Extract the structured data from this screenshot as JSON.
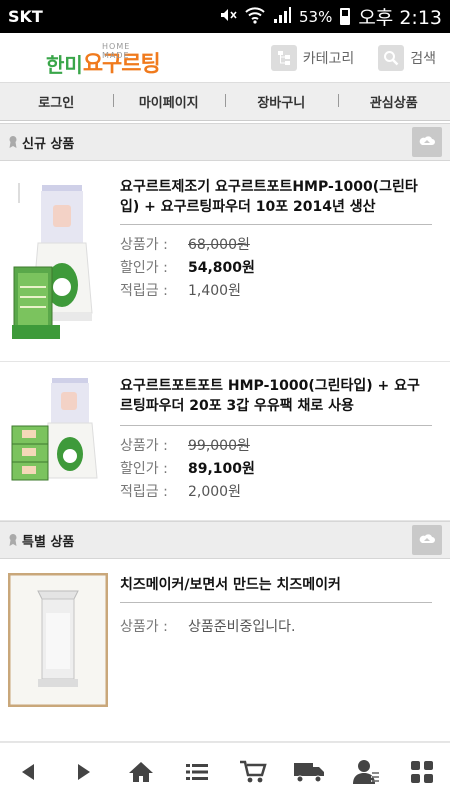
{
  "status_bar": {
    "carrier": "SKT",
    "battery": "53%",
    "time": "오후 2:13"
  },
  "header": {
    "logo_prefix": "한미",
    "logo_main": "요구르팅",
    "logo_sub": "HOME MADE",
    "category_label": "카테고리",
    "search_label": "검색"
  },
  "nav": [
    "로그인",
    "마이페이지",
    "장바구니",
    "관심상품"
  ],
  "sections": {
    "new": {
      "title": "신규 상품",
      "products": [
        {
          "name": "요구르트제조기 요구르트포트HMP-1000(그린타입) + 요구르팅파우더 10포 2014년 생산",
          "price_label": "상품가 :",
          "price": "68,000원",
          "sale_label": "할인가 :",
          "sale_price": "54,800원",
          "points_label": "적립금 :",
          "points": "1,400원"
        },
        {
          "name": "요구르트포트포트 HMP-1000(그린타입) + 요구르팅파우더 20포 3갑 우유팩 채로 사용",
          "price_label": "상품가 :",
          "price": "99,000원",
          "sale_label": "할인가 :",
          "sale_price": "89,100원",
          "points_label": "적립금 :",
          "points": "2,000원"
        }
      ]
    },
    "special": {
      "title": "특별 상품",
      "products": [
        {
          "name": "치즈메이커/보면서 만드는 치즈메이커",
          "price_label": "상품가 :",
          "note": "상품준비중입니다."
        }
      ]
    }
  },
  "colors": {
    "logo_green": "#3aa64a",
    "logo_orange": "#f07a1d",
    "product_green": "#3e9a3a"
  },
  "bottom_bar": [
    "back-icon",
    "forward-icon",
    "home-icon",
    "list-icon",
    "cart-icon",
    "delivery-truck-icon",
    "user-icon",
    "grid-icon"
  ]
}
